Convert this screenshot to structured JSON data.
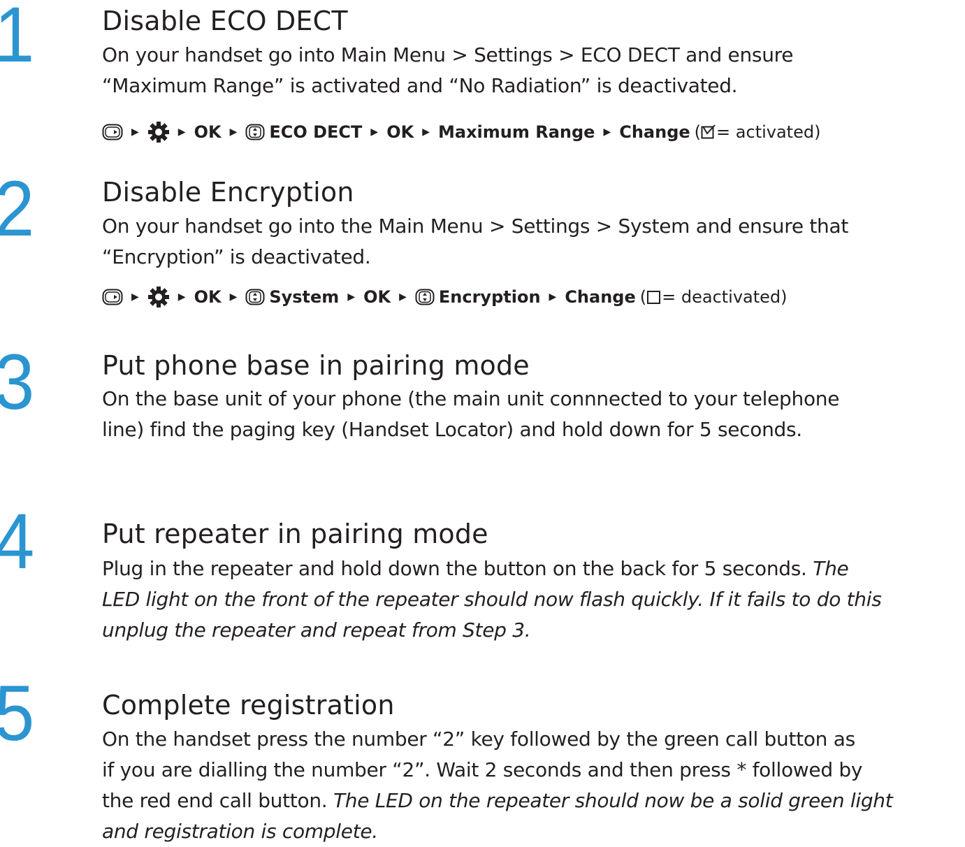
{
  "steps": [
    {
      "number": "1",
      "title": "Disable ECO DECT",
      "body_lines": [
        "On your handset go into Main Menu > Settings > ECO DECT and ensure",
        "“Maximum Range” is activated and “No Radiation” is deactivated."
      ],
      "path": {
        "ok1": "OK",
        "item1": "ECO DECT",
        "ok2": "OK",
        "item2": "Maximum Range",
        "change": "Change",
        "paren_open": "(",
        "state_text": " = activated)"
      }
    },
    {
      "number": "2",
      "title": "Disable Encryption",
      "body_lines": [
        "On your handset go into the Main Menu > Settings > System and ensure that",
        "“Encryption” is deactivated."
      ],
      "path": {
        "ok1": "OK",
        "item1": "System",
        "ok2": "OK",
        "item2": "Encryption",
        "change": "Change",
        "paren_open": "(",
        "state_text": " = deactivated)"
      }
    },
    {
      "number": "3",
      "title": "Put phone base in pairing mode",
      "body_lines": [
        "On the base unit of your phone (the main unit connnected to your telephone",
        "line) find the paging key (Handset Locator) and hold down for 5 seconds."
      ]
    },
    {
      "number": "4",
      "title": "Put repeater in pairing mode",
      "body_line1_normal": "Plug in the repeater and hold down the button on the back for 5 seconds. ",
      "body_line1_italic": "The",
      "body_line2_italic": "LED light on the front of the repeater should now flash quickly. If it fails to do this",
      "body_line3_italic": "unplug the repeater and repeat from Step 3."
    },
    {
      "number": "5",
      "title": "Complete registration",
      "body_line1": "On the handset press the number “2” key followed by the green call button as",
      "body_line2": "if you are dialling the number “2”. Wait 2 seconds and then press * followed by",
      "body_line3_normal": "the red end call button. ",
      "body_line3_italic": "The LED on the repeater should now be a solid green light",
      "body_line4_italic": "and registration is complete."
    }
  ],
  "colors": {
    "step_number": "#2b95d1",
    "text": "#231f20"
  },
  "icons": [
    "menu-key-icon",
    "arrow-right-icon",
    "settings-gear-icon",
    "navigation-key-icon",
    "checked-checkbox-icon",
    "unchecked-checkbox-icon"
  ]
}
